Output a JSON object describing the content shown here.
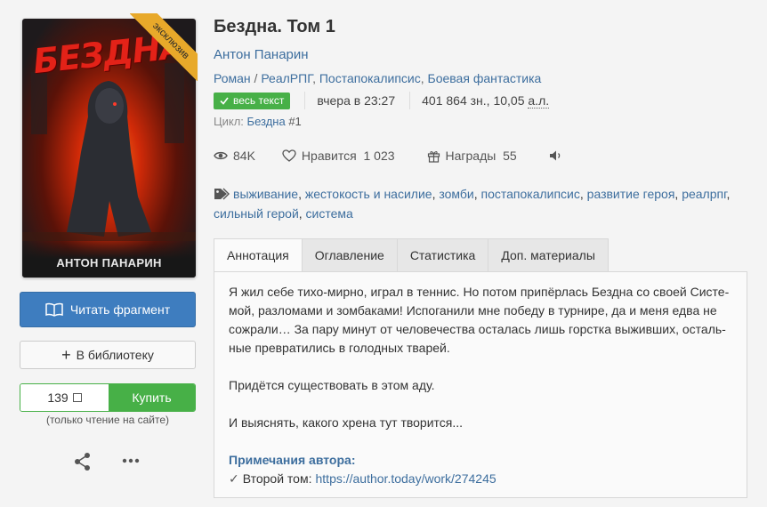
{
  "cover": {
    "title_art": "БЕЗДНА",
    "author_art": "АНТОН ПАНАРИН",
    "ribbon": "эксклюзив"
  },
  "actions": {
    "read_fragment": "Читать фрагмент",
    "add_library": "В библиотеку",
    "price": "139",
    "buy": "Купить",
    "buy_note": "(только чтение на сайте)"
  },
  "book": {
    "title": "Бездна. Том 1",
    "author": "Антон Панарин",
    "genres": [
      "Роман",
      "РеалРПГ",
      "Постапокалипсис",
      "Боевая фантастика"
    ],
    "status_badge": "весь текст",
    "updated": "вчера в 23:27",
    "size": "401 864 зн., 10,05",
    "size_unit": "а.л.",
    "cycle_label": "Цикл:",
    "cycle_name": "Бездна",
    "cycle_num": "#1"
  },
  "stats": {
    "views": "84K",
    "likes": "Нравится  1 023",
    "awards": "Награды  55"
  },
  "tags": [
    "выживание",
    "жестокость и насилие",
    "зомби",
    "постапокалипсис",
    "развитие героя",
    "реалрпг",
    "сильный герой",
    "система"
  ],
  "tabs": [
    "Аннотация",
    "Оглавление",
    "Статистика",
    "Доп. материалы"
  ],
  "annotation": {
    "lines": [
      "Я жил себе тихо-мирно, играл в теннис. Но потом припёрлась Бездна со своей Систе-",
      "мой, разломами и зомбаками! Испоганили мне победу в турнире, да и меня едва не",
      "сожрали… За пару минут от человечества осталась лишь горстка выживших, осталь-",
      "ные превратились в голодных тварей."
    ],
    "para2": "Придётся существовать в этом аду.",
    "para3": "И выяснять, какого хрена тут творится...",
    "notes_title": "Примечания автора:",
    "notes_prefix": "Второй том:",
    "notes_link": "https://author.today/work/274245"
  }
}
